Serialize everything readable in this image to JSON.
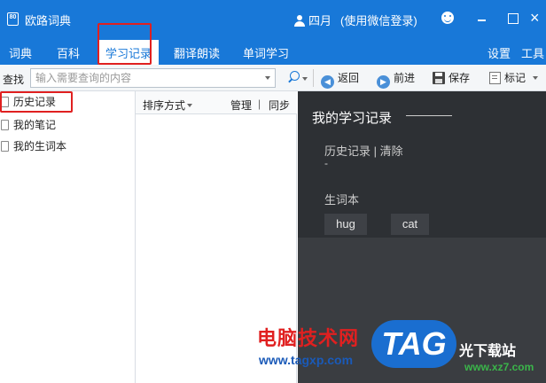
{
  "window": {
    "icon_name": "app-book-icon",
    "app_icon_text": "80",
    "title": "欧路词典",
    "user_name": "四月",
    "login_method": "(使用微信登录)"
  },
  "nav": {
    "tabs": [
      "词典",
      "百科",
      "学习记录",
      "翻译朗读",
      "单词学习"
    ],
    "active_tab": "学习记录",
    "right_items": [
      "设置",
      "工具"
    ]
  },
  "toolbar": {
    "search_label": "查找",
    "search_placeholder": "输入需要查询的内容",
    "back_label": "返回",
    "forward_label": "前进",
    "save_label": "保存",
    "mark_label": "标记"
  },
  "left_panel": {
    "items": [
      "历史记录",
      "我的笔记",
      "我的生词本"
    ],
    "selected": "历史记录"
  },
  "middle_panel": {
    "sort_label": "排序方式",
    "manage_label": "管理",
    "separator": "|",
    "sync_label": "同步"
  },
  "right_panel": {
    "title": "我的学习记录",
    "history_label": "历史记录 | 清除",
    "history_value": "-",
    "vocab_label": "生词本",
    "words": [
      "hug",
      "cat"
    ]
  },
  "watermark": {
    "site_name": "电脑技术网",
    "site_url": "www.tagxp.com",
    "tag_text": "TAG",
    "download_text": "光下载站",
    "download_url": "www.xz7.com"
  },
  "colors": {
    "accent": "#1878d8",
    "highlight": "#e02020",
    "dark_panel": "#2d3034"
  }
}
